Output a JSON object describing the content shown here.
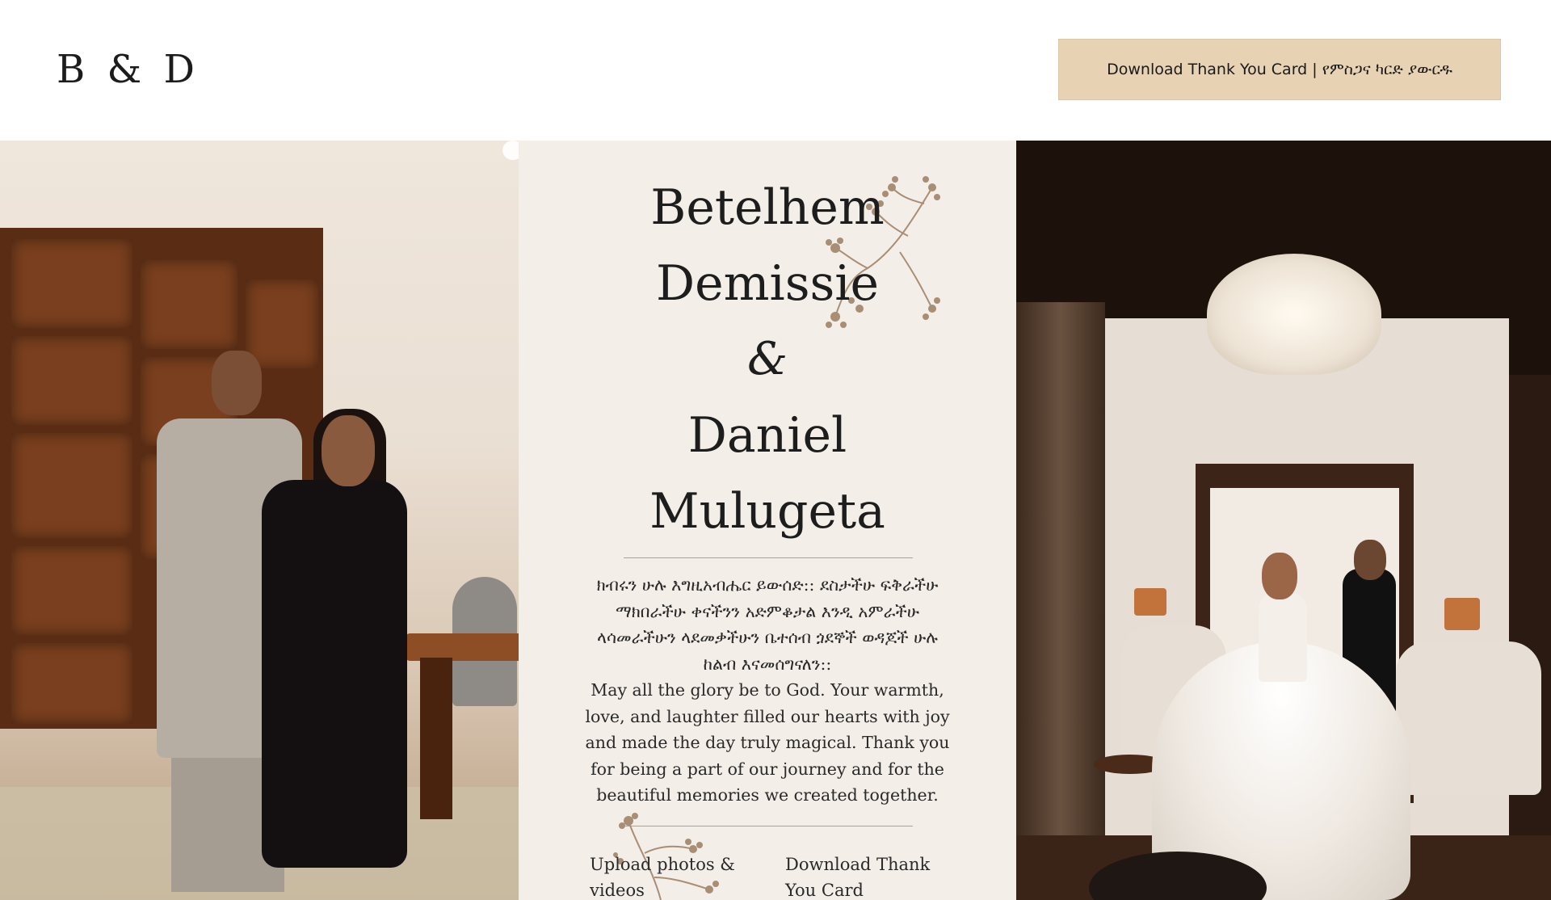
{
  "header": {
    "logo_text": "B & D",
    "download_button_label": "Download Thank You Card | የምስጋና ካርድ ያውርዱ"
  },
  "couple": {
    "bride_first": "Betelhem",
    "bride_last": "Demissie",
    "ampersand": "&",
    "groom_first": "Daniel",
    "groom_last": "Mulugeta"
  },
  "message": {
    "amharic": "ክብሩን ሁሉ እግዚአብሔር ይውሰድ:: ደስታችሁ ፍቅራችሁ ማክበራችሁ ቀናችንን አድምቆታል እንዲ አምራችሁ ላሳመራችሁን ላደመቃችሁን ቤተሰብ ጏደኞች ወዳጆች ሁሉ ከልብ እናመሰግናለን::",
    "english": "May all the glory be to God. Your warmth, love, and laughter filled our hearts with joy and made the day truly magical. Thank you for being a part of our journey and for the beautiful memories we created together."
  },
  "footer_links": {
    "upload": "Upload photos & videos",
    "download": "Download Thank You Card"
  },
  "colors": {
    "button_bg": "#e7d3b4",
    "panel_bg": "#f3eee8",
    "branch": "#a88e74"
  },
  "icons": {
    "logo": "monogram-logo",
    "branch_top": "blossom-branch-icon",
    "branch_bottom": "blossom-branch-icon"
  }
}
